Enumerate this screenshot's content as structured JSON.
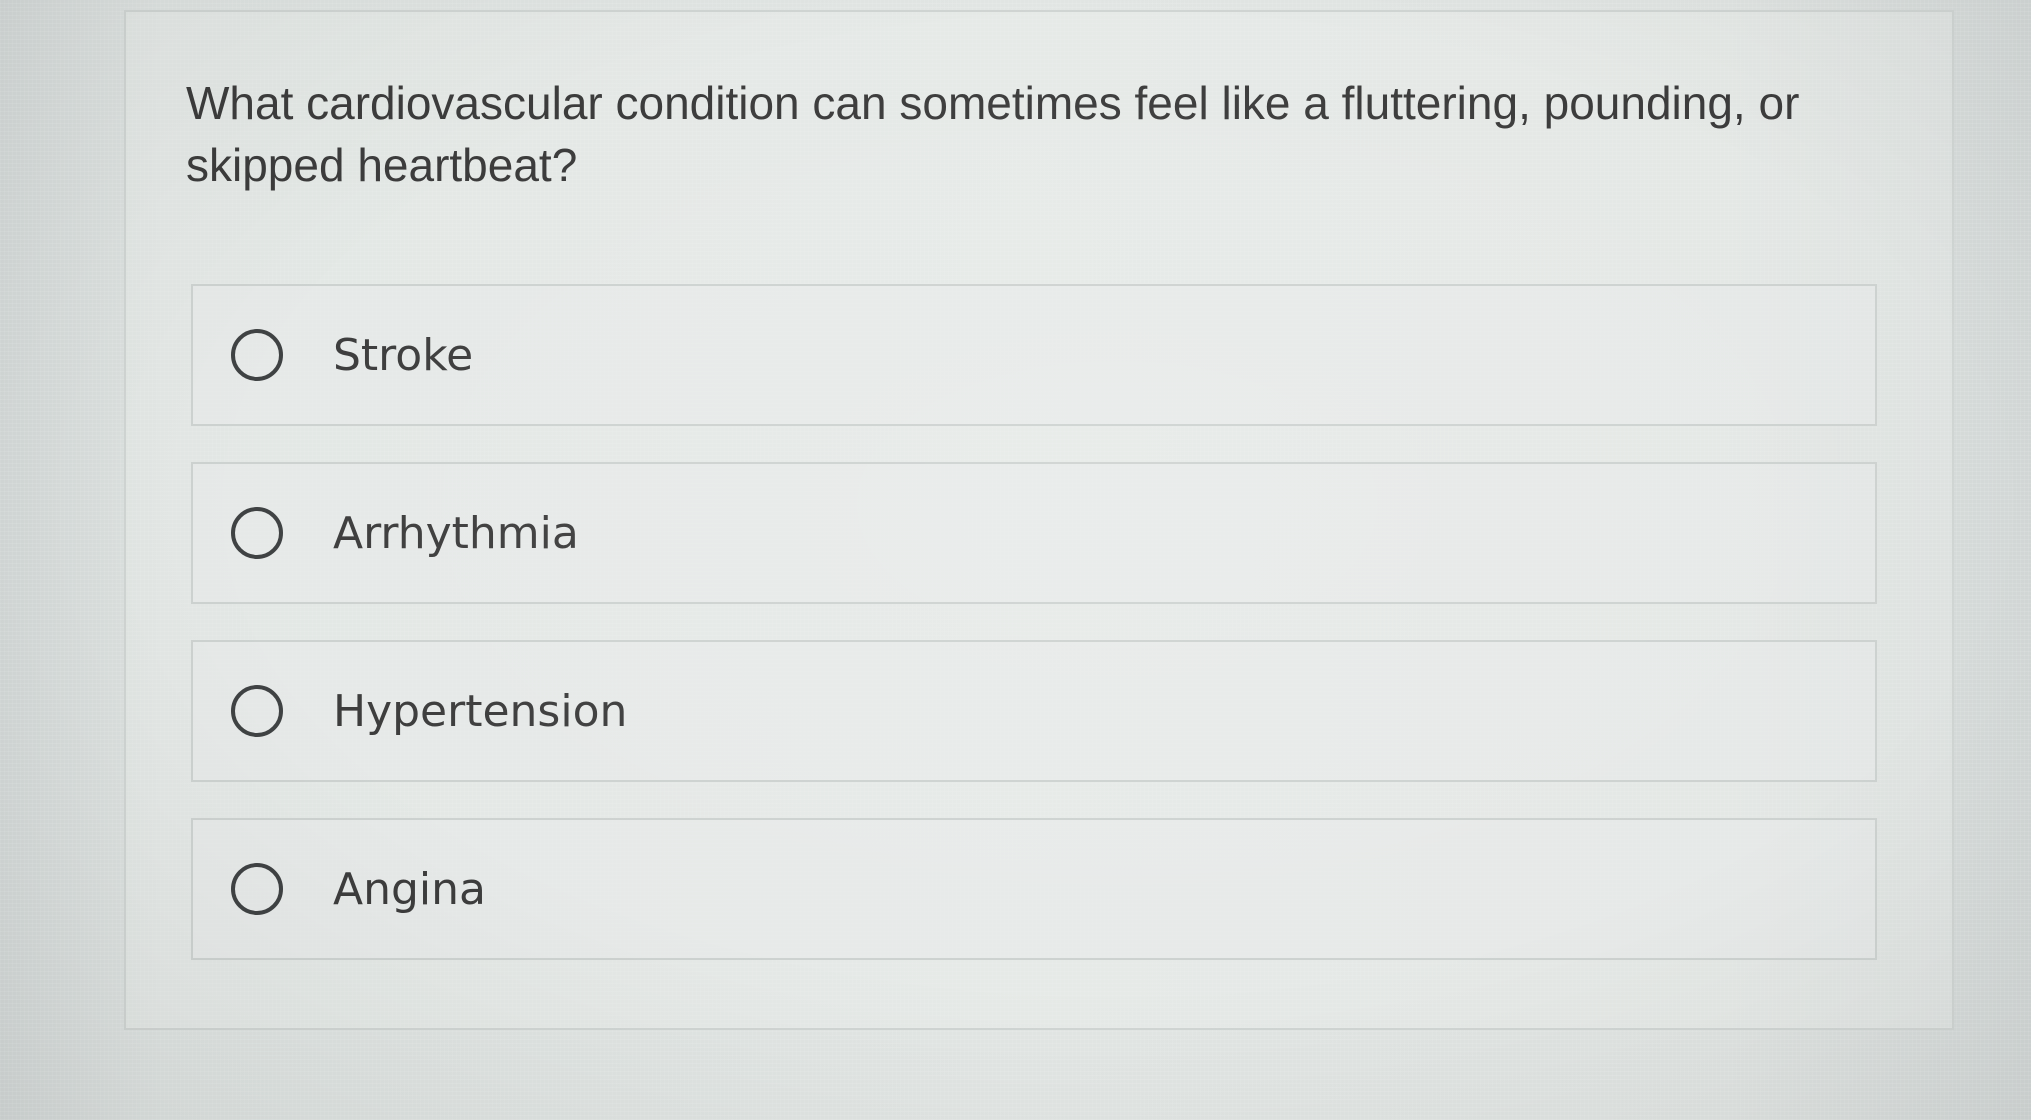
{
  "question": {
    "text": "What cardiovascular condition can sometimes feel like a fluttering, pounding, or skipped heartbeat?"
  },
  "options": [
    {
      "label": "Stroke",
      "selected": false
    },
    {
      "label": "Arrhythmia",
      "selected": false
    },
    {
      "label": "Hypertension",
      "selected": false
    },
    {
      "label": "Angina",
      "selected": false
    }
  ],
  "colors": {
    "text": "#3c3c3c",
    "border": "#cdd2d0",
    "radio": "#3f4243"
  }
}
